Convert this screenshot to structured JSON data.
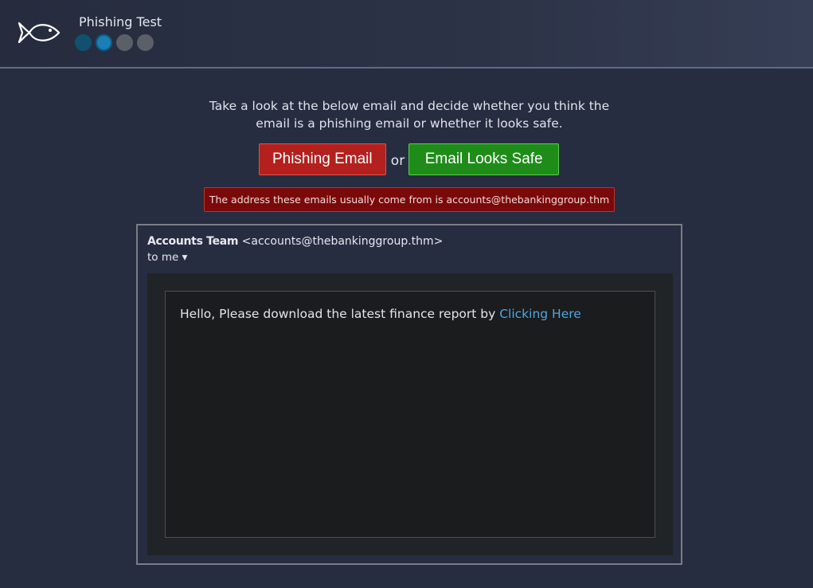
{
  "header": {
    "title": "Phishing Test",
    "logo_icon": "fish-icon",
    "progress": {
      "total": 4,
      "current": 2
    }
  },
  "instructions": "Take a look at the below email and decide whether you think the email is a phishing email or whether it looks safe.",
  "actions": {
    "phishing_label": "Phishing Email",
    "or_label": "or",
    "safe_label": "Email Looks Safe"
  },
  "hint": "The address these emails usually come from is accounts@thebankinggroup.thm",
  "email": {
    "sender_name": "Accounts Team",
    "sender_address": "<accounts@thebankinggroup.thm>",
    "recipient": "to me ▾",
    "body_text": "Hello, Please download the latest finance report by ",
    "link_text": "Clicking Here"
  },
  "colors": {
    "background": "#272d40",
    "phishing_button": "#b3201d",
    "safe_button": "#1f8c1a",
    "hint_background": "#7a0a0a",
    "link": "#4fa6e0",
    "progress_current": "#1a7fb6",
    "progress_done": "#11506f",
    "progress_todo": "#5b5f67"
  }
}
